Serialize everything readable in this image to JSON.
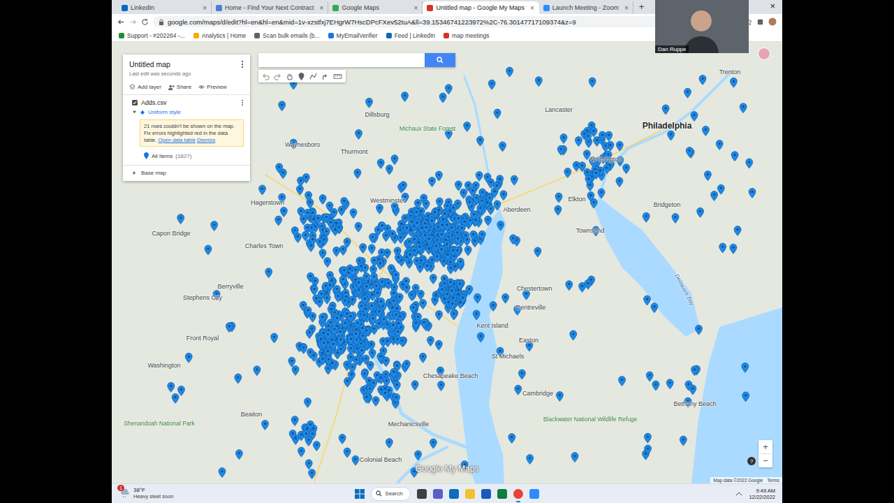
{
  "browser": {
    "tabs": [
      {
        "label": "LinkedIn",
        "selected": false,
        "color": "#0a66c2"
      },
      {
        "label": "Home - Find Your Next Contract",
        "selected": false,
        "color": "#4a7fd6"
      },
      {
        "label": "Google Maps",
        "selected": false,
        "color": "#34a853"
      },
      {
        "label": "Untitled map - Google My Maps",
        "selected": true,
        "color": "#d93025"
      },
      {
        "label": "Launch Meeting - Zoom",
        "selected": false,
        "color": "#2d8cff"
      }
    ],
    "tab_close": "×",
    "new_tab": "+",
    "window_close": "×",
    "address": "google.com/maps/d/edit?hl=en&hl=en&mid=1v-xzstfxj7EHgrW7HscDPcFXev52tuA&ll=39.15346741223972%2C-76.30147717109374&z=9",
    "bookmarks": [
      {
        "label": "Support - #202264 -...",
        "color": "#1e8e3e"
      },
      {
        "label": "Analytics | Home",
        "color": "#f9ab00"
      },
      {
        "label": "Scan bulk emails (b...",
        "color": "#5f6368"
      },
      {
        "label": "MyEmailVerifier",
        "color": "#1a73e8"
      },
      {
        "label": "Feed | LinkedIn",
        "color": "#0a66c2"
      },
      {
        "label": "map meetings",
        "color": "#d93025"
      }
    ]
  },
  "map_panel": {
    "title": "Untitled map",
    "subtitle": "Last edit was seconds ago",
    "actions": [
      "Add layer",
      "Share",
      "Preview"
    ],
    "layer": {
      "name": "Adds.csv",
      "checked": true,
      "expanded": true,
      "style": "Uniform style",
      "warning": "21 rows couldn't be shown on the map. Fix errors highlighted red in the data table.",
      "warning_links": [
        "Open data table",
        "Dismiss"
      ],
      "items": "All items",
      "count": "(1827)"
    },
    "base_map": "Base map"
  },
  "map": {
    "logo": "Google My Maps",
    "attribution": "Map data ©2022 Google",
    "terms": "Terms",
    "zoom_in": "+",
    "zoom_out": "−",
    "help": "?",
    "labels": [
      "Trenton",
      "Philadelphia",
      "Lancaster",
      "Dillsburg",
      "Michaux State Forest",
      "Waynesboro",
      "Hagerstown",
      "Thurmont",
      "Westminster",
      "Aberdeen",
      "Elkton",
      "Wilmington",
      "Bridgeton",
      "Townsend",
      "Chestertown",
      "Centreville",
      "Kent Island",
      "Easton",
      "St Michaels",
      "Cambridge",
      "Chesapeake Beach",
      "Mechanicsville",
      "Colonial Beach",
      "Capon Bridge",
      "Charles Town",
      "Berryville",
      "Stephens City",
      "Front Royal",
      "Washington",
      "Beaiton",
      "Shenandoah National Park",
      "Blackwater National Wildlife Refuge",
      "Bethany Beach",
      "Delaware Bay"
    ]
  },
  "video_call": {
    "participant": "Dan Ruppe"
  },
  "taskbar": {
    "badge": "1",
    "temperature": "38°F",
    "weather": "Heavy sleet soon",
    "search": "Search",
    "time": "9:49 AM",
    "date": "12/22/2022"
  }
}
